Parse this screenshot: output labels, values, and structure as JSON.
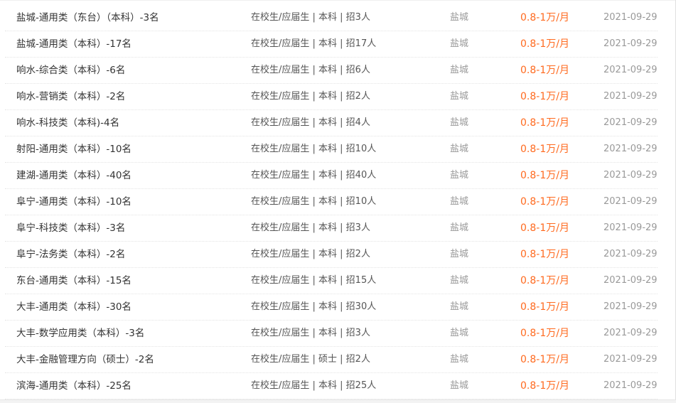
{
  "jobs": [
    {
      "title": "盐城-通用类（东台）（本科）-3名",
      "requirement": "在校生/应届生 | 本科 | 招3人",
      "city": "盐城",
      "salary": "0.8-1万/月",
      "date": "2021-09-29"
    },
    {
      "title": "盐城-通用类（本科）-17名",
      "requirement": "在校生/应届生 | 本科 | 招17人",
      "city": "盐城",
      "salary": "0.8-1万/月",
      "date": "2021-09-29"
    },
    {
      "title": "响水-综合类（本科）-6名",
      "requirement": "在校生/应届生 | 本科 | 招6人",
      "city": "盐城",
      "salary": "0.8-1万/月",
      "date": "2021-09-29"
    },
    {
      "title": "响水-营销类（本科）-2名",
      "requirement": "在校生/应届生 | 本科 | 招2人",
      "city": "盐城",
      "salary": "0.8-1万/月",
      "date": "2021-09-29"
    },
    {
      "title": "响水-科技类（本科)-4名",
      "requirement": "在校生/应届生 | 本科 | 招4人",
      "city": "盐城",
      "salary": "0.8-1万/月",
      "date": "2021-09-29"
    },
    {
      "title": "射阳-通用类（本科）-10名",
      "requirement": "在校生/应届生 | 本科 | 招10人",
      "city": "盐城",
      "salary": "0.8-1万/月",
      "date": "2021-09-29"
    },
    {
      "title": "建湖-通用类（本科）-40名",
      "requirement": "在校生/应届生 | 本科 | 招40人",
      "city": "盐城",
      "salary": "0.8-1万/月",
      "date": "2021-09-29"
    },
    {
      "title": "阜宁-通用类（本科）-10名",
      "requirement": "在校生/应届生 | 本科 | 招10人",
      "city": "盐城",
      "salary": "0.8-1万/月",
      "date": "2021-09-29"
    },
    {
      "title": "阜宁-科技类（本科）-3名",
      "requirement": "在校生/应届生 | 本科 | 招3人",
      "city": "盐城",
      "salary": "0.8-1万/月",
      "date": "2021-09-29"
    },
    {
      "title": "阜宁-法务类（本科）-2名",
      "requirement": "在校生/应届生 | 本科 | 招2人",
      "city": "盐城",
      "salary": "0.8-1万/月",
      "date": "2021-09-29"
    },
    {
      "title": "东台-通用类（本科）-15名",
      "requirement": "在校生/应届生 | 本科 | 招15人",
      "city": "盐城",
      "salary": "0.8-1万/月",
      "date": "2021-09-29"
    },
    {
      "title": "大丰-通用类（本科）-30名",
      "requirement": "在校生/应届生 | 本科 | 招30人",
      "city": "盐城",
      "salary": "0.8-1万/月",
      "date": "2021-09-29"
    },
    {
      "title": "大丰-数学应用类（本科）-3名",
      "requirement": "在校生/应届生 | 本科 | 招3人",
      "city": "盐城",
      "salary": "0.8-1万/月",
      "date": "2021-09-29"
    },
    {
      "title": "大丰-金融管理方向（硕士）-2名",
      "requirement": "在校生/应届生 | 硕士 | 招2人",
      "city": "盐城",
      "salary": "0.8-1万/月",
      "date": "2021-09-29"
    },
    {
      "title": "滨海-通用类（本科）-25名",
      "requirement": "在校生/应届生 | 本科 | 招25人",
      "city": "盐城",
      "salary": "0.8-1万/月",
      "date": "2021-09-29"
    }
  ],
  "colors": {
    "salary": "#ff6a1f",
    "title": "#333333",
    "muted": "#999999"
  }
}
